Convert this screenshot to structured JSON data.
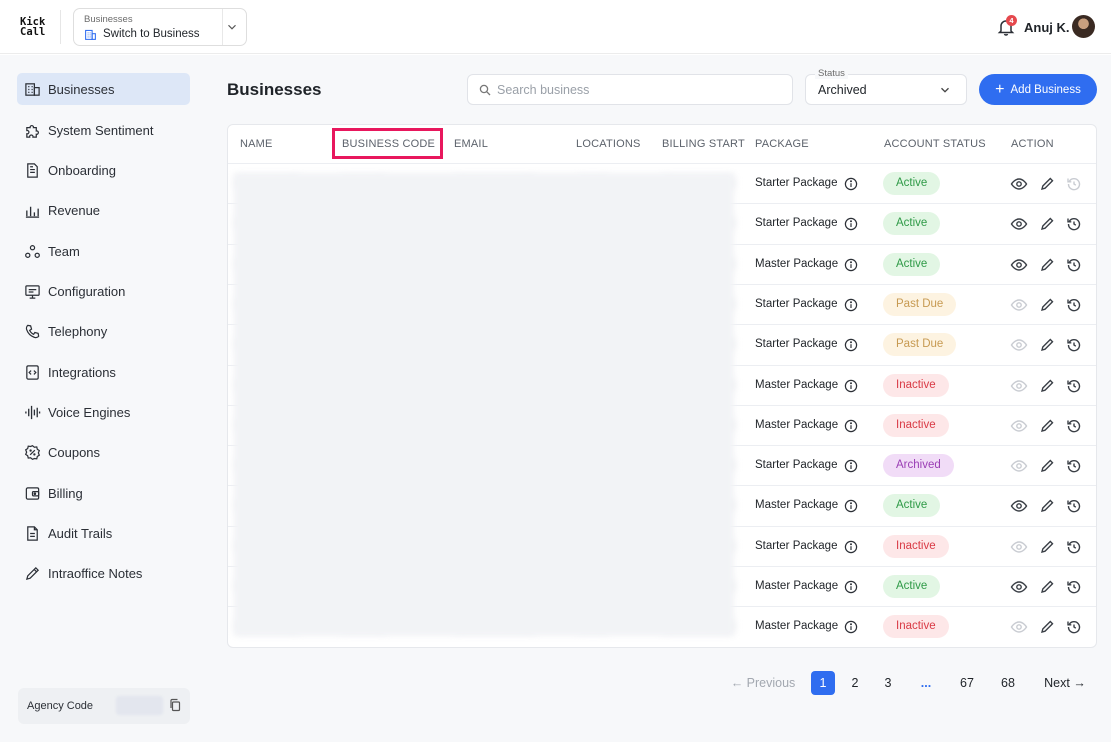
{
  "app": {
    "logo_line1": "Kick",
    "logo_line2": "Call",
    "switcher_caption": "Businesses",
    "switcher_label": "Switch to Business",
    "notification_count": "4",
    "user_name": "Anuj K."
  },
  "sidebar": {
    "items": [
      {
        "label": "Businesses",
        "icon": "building-icon",
        "active": true
      },
      {
        "label": "System Sentiment",
        "icon": "puzzle-icon"
      },
      {
        "label": "Onboarding",
        "icon": "document-icon"
      },
      {
        "label": "Revenue",
        "icon": "chart-icon"
      },
      {
        "label": "Team",
        "icon": "team-icon"
      },
      {
        "label": "Configuration",
        "icon": "monitor-icon"
      },
      {
        "label": "Telephony",
        "icon": "phone-icon"
      },
      {
        "label": "Integrations",
        "icon": "code-icon"
      },
      {
        "label": "Voice Engines",
        "icon": "waveform-icon"
      },
      {
        "label": "Coupons",
        "icon": "coupon-icon"
      },
      {
        "label": "Billing",
        "icon": "wallet-icon"
      },
      {
        "label": "Audit Trails",
        "icon": "file-text-icon"
      },
      {
        "label": "Intraoffice Notes",
        "icon": "pencil-icon"
      }
    ],
    "agency_label": "Agency Code"
  },
  "main": {
    "title": "Businesses",
    "search_placeholder": "Search business",
    "status_caption": "Status",
    "status_value": "Archived",
    "add_button_label": "Add Business"
  },
  "table": {
    "columns": [
      "NAME",
      "BUSINESS CODE",
      "EMAIL",
      "LOCATIONS",
      "BILLING START",
      "PACKAGE",
      "ACCOUNT STATUS",
      "ACTION"
    ],
    "rows": [
      {
        "package": "Starter Package",
        "status": "Active",
        "view_enabled": true,
        "restore_enabled": false
      },
      {
        "package": "Starter Package",
        "status": "Active",
        "view_enabled": true,
        "restore_enabled": true
      },
      {
        "package": "Master Package",
        "status": "Active",
        "view_enabled": true,
        "restore_enabled": true
      },
      {
        "package": "Starter Package",
        "status": "Past Due",
        "view_enabled": false,
        "restore_enabled": true
      },
      {
        "package": "Starter Package",
        "status": "Past Due",
        "view_enabled": false,
        "restore_enabled": true
      },
      {
        "package": "Master Package",
        "status": "Inactive",
        "view_enabled": false,
        "restore_enabled": true
      },
      {
        "package": "Master Package",
        "status": "Inactive",
        "view_enabled": false,
        "restore_enabled": true
      },
      {
        "package": "Starter Package",
        "status": "Archived",
        "view_enabled": false,
        "restore_enabled": true
      },
      {
        "package": "Master Package",
        "status": "Active",
        "view_enabled": true,
        "restore_enabled": true
      },
      {
        "package": "Starter Package",
        "status": "Inactive",
        "view_enabled": false,
        "restore_enabled": true
      },
      {
        "package": "Master Package",
        "status": "Active",
        "view_enabled": true,
        "restore_enabled": true
      },
      {
        "package": "Master Package",
        "status": "Inactive",
        "view_enabled": false,
        "restore_enabled": true
      }
    ]
  },
  "pagination": {
    "previous_label": "Previous",
    "next_label": "Next",
    "pages": [
      "1",
      "2",
      "3",
      "...",
      "67",
      "68"
    ],
    "current": "1"
  },
  "colors": {
    "accent": "#2f6df0",
    "highlight": "#e8175d",
    "active": "#2f9a47",
    "past_due": "#c79a52",
    "inactive": "#d93a45",
    "archived": "#9b3fb5"
  }
}
